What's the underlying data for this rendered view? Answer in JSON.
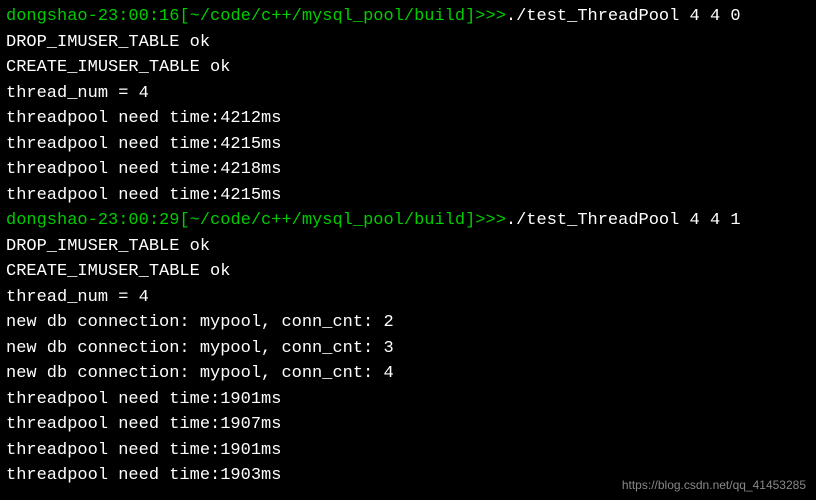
{
  "lines": [
    {
      "type": "prompt",
      "user_time": "dongshao-23:00:16",
      "path": "[~/code/c++/mysql_pool/build]",
      "arrow": ">>>",
      "command": "./test_ThreadPool 4 4 0"
    },
    {
      "type": "output",
      "text": "DROP_IMUSER_TABLE ok"
    },
    {
      "type": "output",
      "text": "CREATE_IMUSER_TABLE ok"
    },
    {
      "type": "output",
      "text": "thread_num = 4"
    },
    {
      "type": "output",
      "text": "threadpool need time:4212ms"
    },
    {
      "type": "output",
      "text": "threadpool need time:4215ms"
    },
    {
      "type": "output",
      "text": "threadpool need time:4218ms"
    },
    {
      "type": "output",
      "text": "threadpool need time:4215ms"
    },
    {
      "type": "prompt",
      "user_time": "dongshao-23:00:29",
      "path": "[~/code/c++/mysql_pool/build]",
      "arrow": ">>>",
      "command": "./test_ThreadPool 4 4 1"
    },
    {
      "type": "output",
      "text": "DROP_IMUSER_TABLE ok"
    },
    {
      "type": "output",
      "text": "CREATE_IMUSER_TABLE ok"
    },
    {
      "type": "output",
      "text": "thread_num = 4"
    },
    {
      "type": "output",
      "text": "new db connection: mypool, conn_cnt: 2"
    },
    {
      "type": "output",
      "text": "new db connection: mypool, conn_cnt: 3"
    },
    {
      "type": "output",
      "text": "new db connection: mypool, conn_cnt: 4"
    },
    {
      "type": "output",
      "text": "threadpool need time:1901ms"
    },
    {
      "type": "output",
      "text": "threadpool need time:1907ms"
    },
    {
      "type": "output",
      "text": "threadpool need time:1901ms"
    },
    {
      "type": "output",
      "text": "threadpool need time:1903ms"
    }
  ],
  "watermark": "https://blog.csdn.net/qq_41453285"
}
